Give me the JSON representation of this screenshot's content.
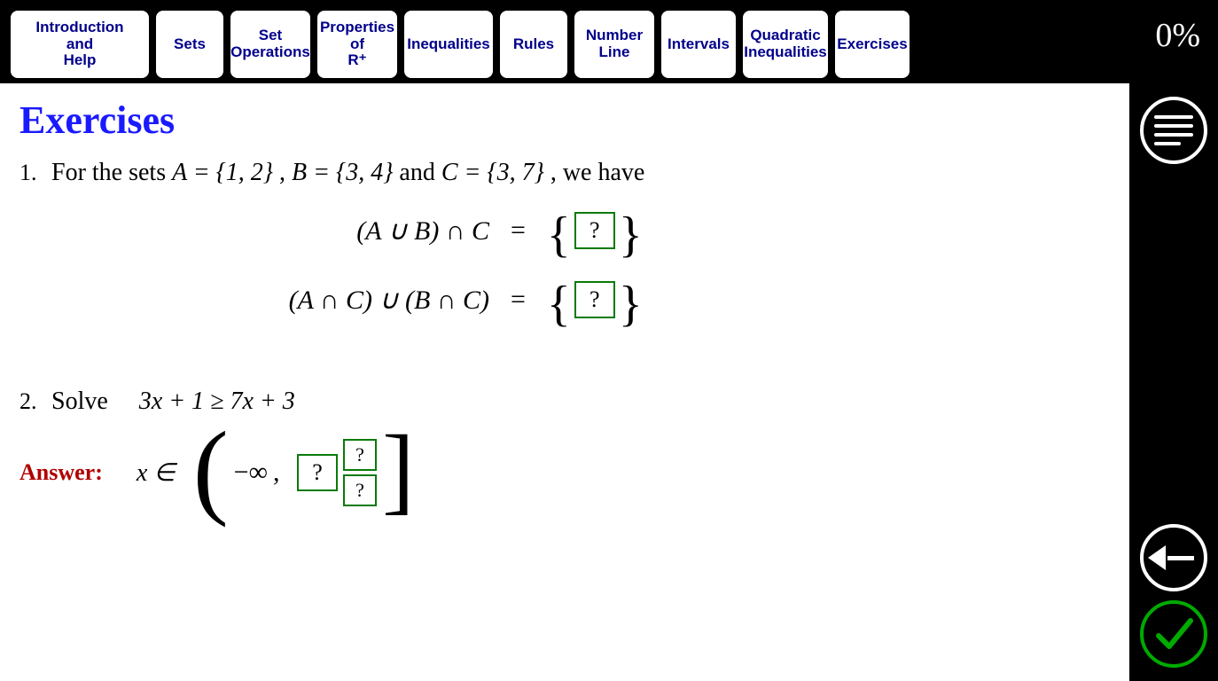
{
  "progress": "0%",
  "tabs": [
    "Introduction\nand\nHelp",
    "Sets",
    "Set\nOperations",
    "Properties\nof\nR⁺",
    "Inequalities",
    "Rules",
    "Number\nLine",
    "Intervals",
    "Quadratic\nInequalities",
    "Exercises"
  ],
  "title": "Exercises",
  "q1": {
    "num": "1.",
    "text_prefix": "For the sets ",
    "setA": "A = {1, 2}",
    "sep1": ", ",
    "setB": "B = {3, 4}",
    "and_word": " and ",
    "setC": "C = {3, 7}",
    "text_suffix": ", we have",
    "eq1_lhs": "(A ∪ B) ∩ C",
    "eq2_lhs": "(A ∩ C) ∪ (B ∩ C)",
    "equals": "=",
    "brace_open": "{",
    "brace_close": "}",
    "placeholder": "?"
  },
  "q2": {
    "num": "2.",
    "solve_label": "Solve",
    "inequality": "3x + 1 ≥ 7x + 3",
    "answer_label": "Answer:",
    "x_in": "x ∈",
    "paren_open": "(",
    "neg_inf": "−∞",
    "comma": ",",
    "bracket_close": "]",
    "placeholder": "?"
  },
  "icons": {
    "menu": "menu-icon",
    "back": "back-arrow-icon",
    "check": "checkmark-icon"
  }
}
